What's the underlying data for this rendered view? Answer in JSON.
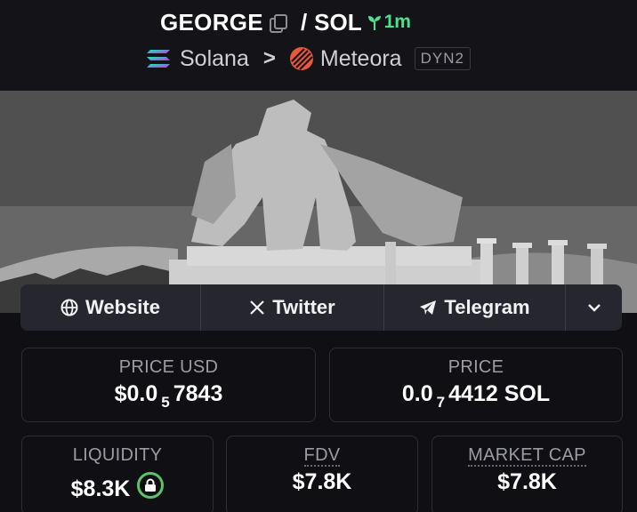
{
  "header": {
    "token_symbol": "GEORGE",
    "slash": "/",
    "quote_symbol": "SOL",
    "age": "1m",
    "chain": "Solana",
    "separator": ">",
    "dex": "Meteora",
    "pool_badge": "DYN2"
  },
  "links": {
    "website": "Website",
    "twitter": "Twitter",
    "telegram": "Telegram"
  },
  "stats": {
    "price_usd": {
      "label": "PRICE USD",
      "prefix": "$0.0",
      "zeros": "5",
      "digits": "7843"
    },
    "price": {
      "label": "PRICE",
      "prefix": "0.0",
      "zeros": "7",
      "digits": "4412 SOL"
    },
    "liquidity": {
      "label": "LIQUIDITY",
      "value": "$8.3K"
    },
    "fdv": {
      "label": "FDV",
      "value": "$7.8K"
    },
    "market_cap": {
      "label": "MARKET CAP",
      "value": "$7.8K"
    }
  },
  "colors": {
    "accent_green": "#4fe08e",
    "lock_green": "#5cc36a",
    "background": "#0f0f14"
  },
  "icons": [
    "copy-icon",
    "sprout-icon",
    "solana-icon",
    "meteora-icon",
    "globe-icon",
    "x-icon",
    "telegram-icon",
    "chevron-down-icon",
    "lock-icon"
  ]
}
